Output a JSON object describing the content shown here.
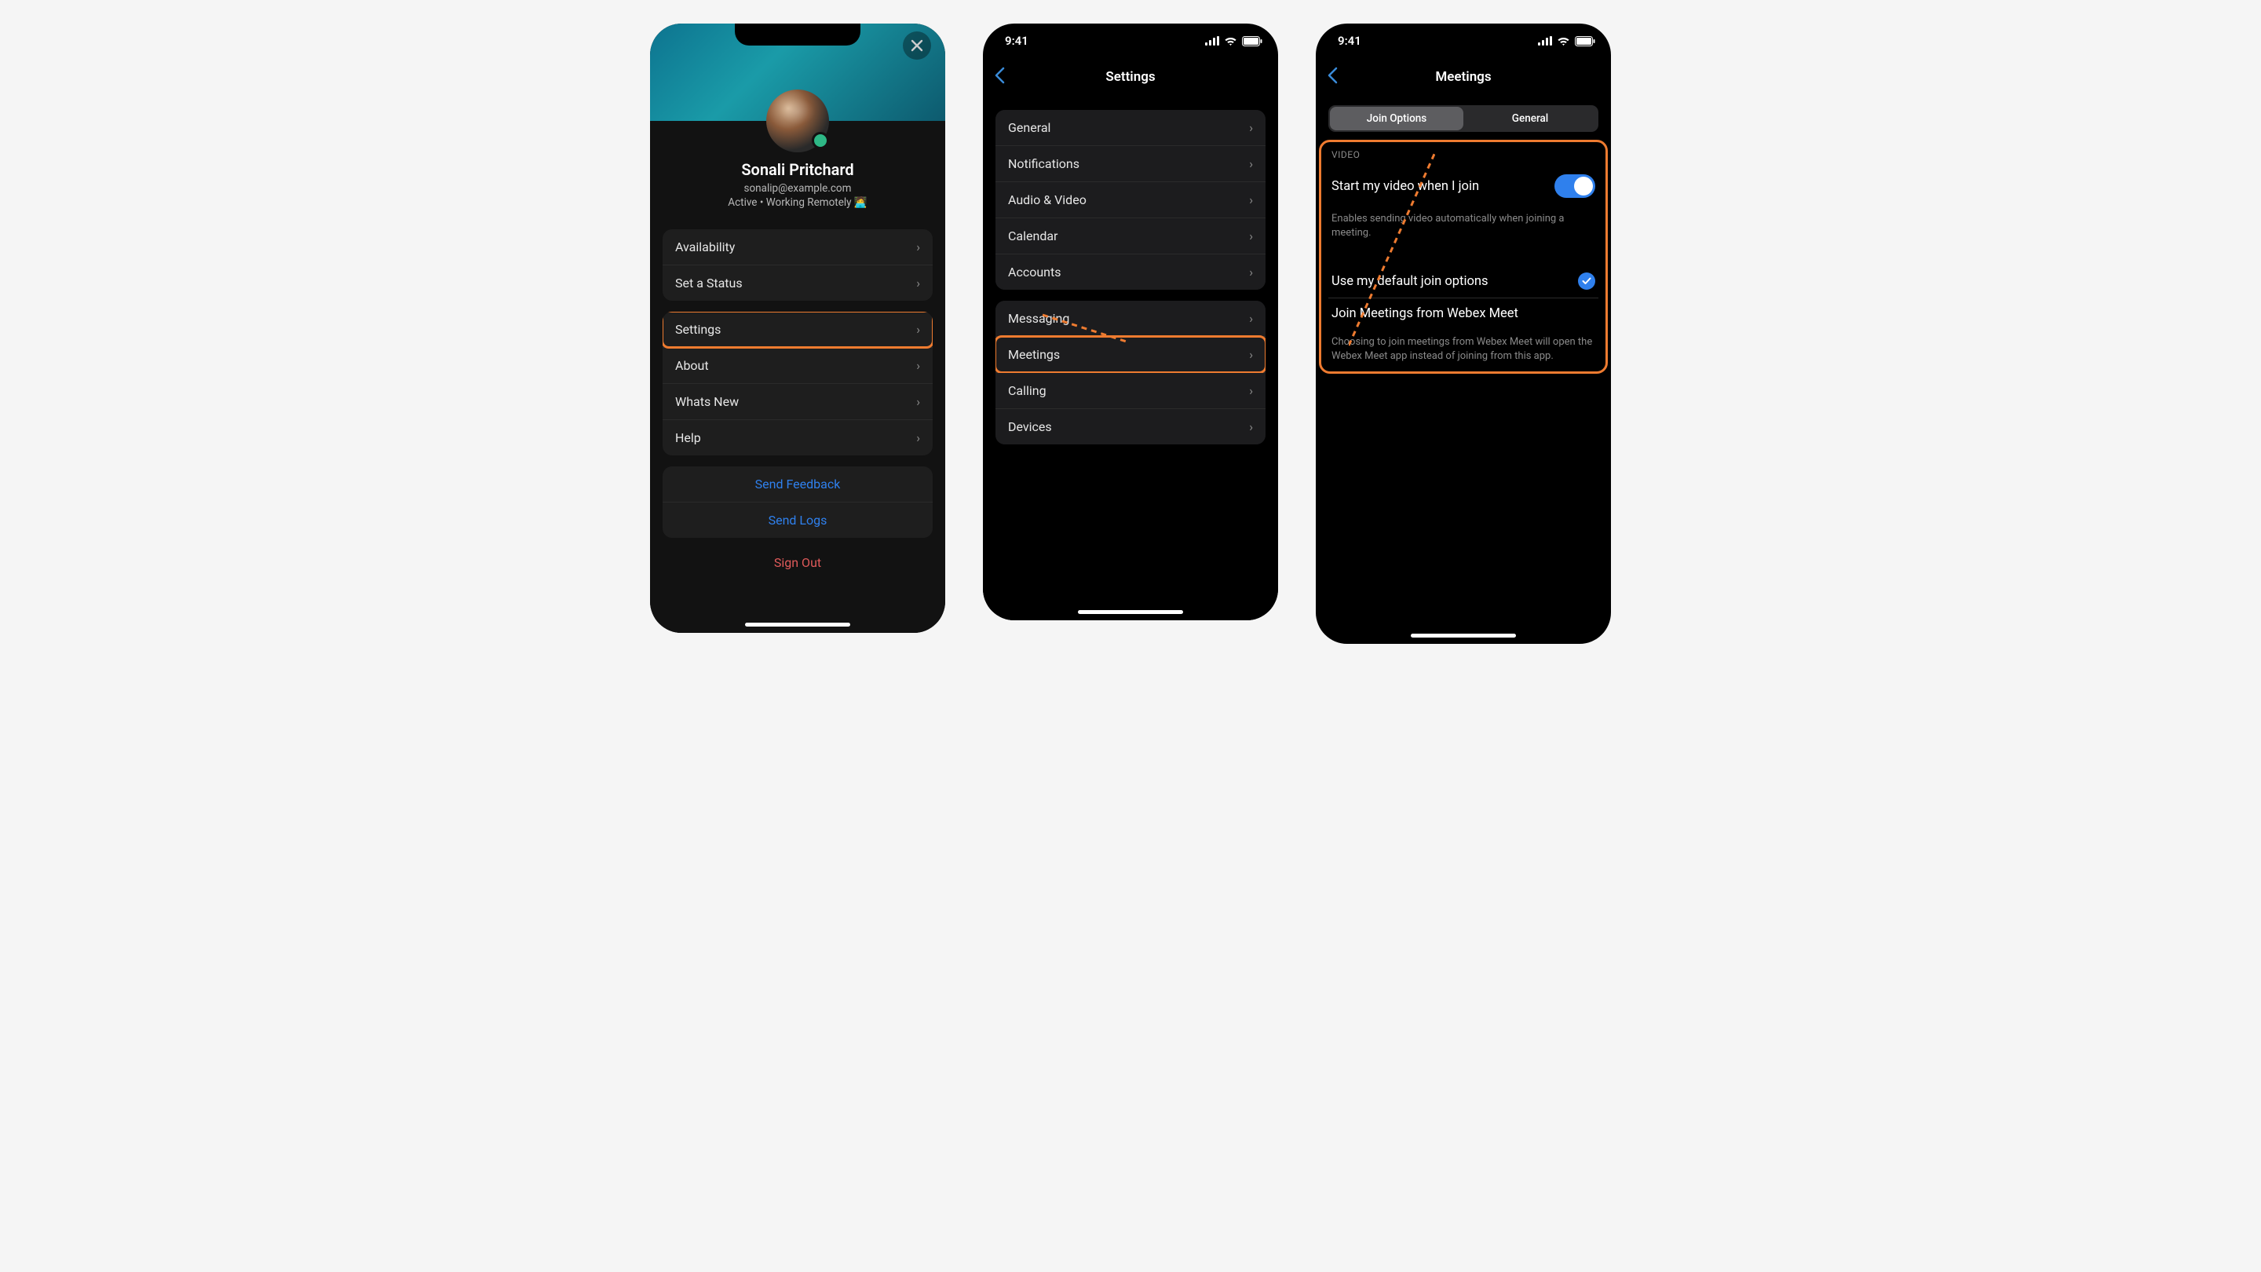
{
  "statusbar": {
    "time": "9:41"
  },
  "screen1": {
    "profile": {
      "name": "Sonali Pritchard",
      "email": "sonalip@example.com",
      "status_line": "Active • Working Remotely 🧑‍💻"
    },
    "group1": {
      "availability": "Availability",
      "set_status": "Set a Status"
    },
    "group2": {
      "settings": "Settings",
      "about": "About",
      "whats_new": "Whats New",
      "help": "Help"
    },
    "group3": {
      "send_feedback": "Send Feedback",
      "send_logs": "Send Logs"
    },
    "sign_out": "Sign Out"
  },
  "screen2": {
    "title": "Settings",
    "group1": {
      "general": "General",
      "notifications": "Notifications",
      "audio_video": "Audio & Video",
      "calendar": "Calendar",
      "accounts": "Accounts"
    },
    "group2": {
      "messaging": "Messaging",
      "meetings": "Meetings",
      "calling": "Calling",
      "devices": "Devices"
    }
  },
  "screen3": {
    "title": "Meetings",
    "seg": {
      "join_options": "Join Options",
      "general": "General"
    },
    "video_section": "VIDEO",
    "start_video": "Start my video when I join",
    "start_video_desc": "Enables sending video automatically when joining a meeting.",
    "use_default": "Use my default join options",
    "join_from_meet": "Join Meetings from Webex Meet",
    "join_from_meet_desc": "Choosing to join meetings from Webex Meet will open the Webex Meet app instead of joining from this app."
  }
}
